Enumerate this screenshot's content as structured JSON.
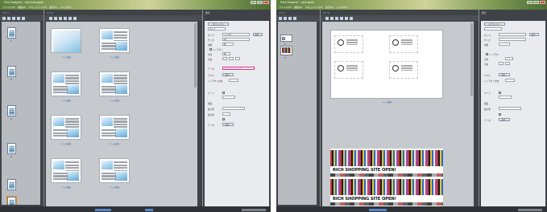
{
  "screens": [
    {
      "id": "w1",
      "title_bar": "Print Designer - brochure.ppdx",
      "menu": [
        "ファイル(F)",
        "編集(E)",
        "ドキュメント(D)",
        "表示(V)",
        "ヘルプ(H)"
      ],
      "page_panel_label": "ページ",
      "canvas_label": "ページ",
      "props_label": "書式",
      "page_numbers": [
        "1",
        "2",
        "3",
        "4"
      ],
      "captions": [
        "ページ前面",
        "ページ背面"
      ],
      "properties": {
        "tab": "オブジェクト",
        "rows": [
          "タイプ",
          "サイズ",
          "用紙",
          "レイアウト",
          "方向",
          "余白",
          "データ",
          "ラベル",
          "レイアウト方向",
          "カード",
          "紙面",
          "拡大率",
          "データ"
        ],
        "values": [
          "A4",
          "ふりがな",
          "縦",
          "横"
        ],
        "buttons": [
          "設定...",
          "設定..."
        ],
        "colored_text": "マルチカラーテキスト"
      }
    },
    {
      "id": "w2",
      "title_bar": "Print Designer - card.ppdx",
      "menu": [
        "ファイル(F)",
        "編集(E)",
        "ドキュメント(D)",
        "表示(V)",
        "ヘルプ(H)"
      ],
      "page_panel_label": "ページ",
      "canvas_label": "ページ",
      "props_label": "書式",
      "page_numbers": [
        "1",
        "2"
      ],
      "captions": [
        "ページ前面"
      ],
      "poster_text": "RICH SHOPPING SITE OPEN!",
      "properties": {
        "tab": "オブジェクト",
        "rows": [
          "タイプ",
          "サイズ",
          "用紙",
          "レイアウト",
          "方向",
          "余白",
          "ラベル",
          "レイアウト方向",
          "カード",
          "紙面",
          "拡大率",
          "データ"
        ],
        "buttons": [
          "設定...",
          "設定..."
        ]
      }
    }
  ]
}
